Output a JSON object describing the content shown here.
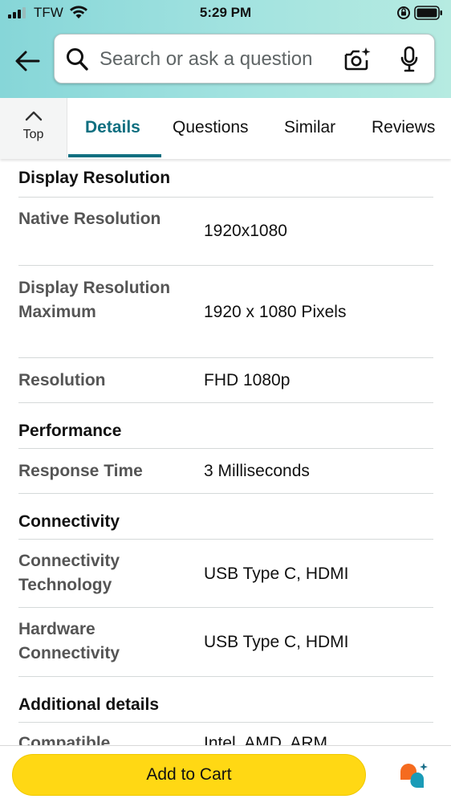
{
  "status_bar": {
    "carrier": "TFW",
    "time": "5:29 PM"
  },
  "search": {
    "placeholder": "Search or ask a question"
  },
  "tabs": {
    "top_label": "Top",
    "items": [
      "Details",
      "Questions",
      "Similar",
      "Reviews"
    ],
    "active": "Details"
  },
  "details": {
    "display_resolution": {
      "title": "Display Resolution",
      "rows": [
        {
          "label": "Native Resolution",
          "value": "1920x1080"
        },
        {
          "label": "Display Resolution Maximum",
          "value": "1920 x 1080 Pixels"
        },
        {
          "label": "Resolution",
          "value": "FHD 1080p"
        }
      ]
    },
    "performance": {
      "title": "Performance",
      "rows": [
        {
          "label": "Response Time",
          "value": "3 Milliseconds"
        }
      ]
    },
    "connectivity": {
      "title": "Connectivity",
      "rows": [
        {
          "label": "Connectivity Technology",
          "value": "USB Type C, HDMI"
        },
        {
          "label": "Hardware Connectivity",
          "value": "USB Type C, HDMI"
        }
      ]
    },
    "additional": {
      "title": "Additional details",
      "rows": [
        {
          "label": "Compatible",
          "value": "Intel, AMD, ARM"
        }
      ]
    }
  },
  "bottom_bar": {
    "add_to_cart_label": "Add to Cart"
  },
  "colors": {
    "header_gradient_start": "#86d6d8",
    "header_gradient_end": "#b6ebe1",
    "active_tab": "#0f6f80",
    "add_to_cart": "#ffd814",
    "assistant_orange": "#f56b1f",
    "assistant_teal": "#1a9bb7"
  },
  "icons": {
    "back": "arrow-left-icon",
    "search": "search-icon",
    "camera": "camera-sparkle-icon",
    "mic": "microphone-icon",
    "top": "chevron-up-icon",
    "assistant": "rufus-assistant-icon"
  }
}
